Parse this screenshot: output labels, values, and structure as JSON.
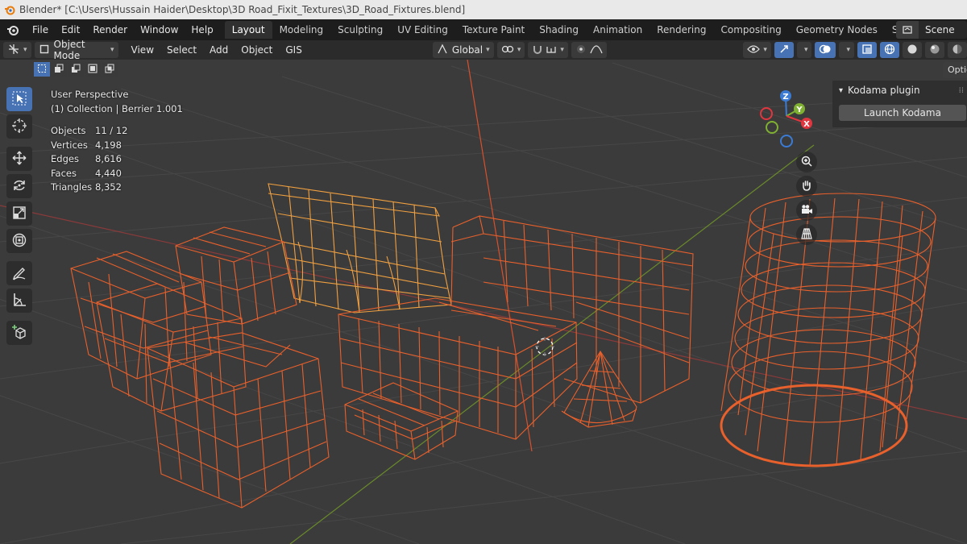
{
  "titlebar": {
    "text": "Blender* [C:\\Users\\Hussain Haider\\Desktop\\3D Road_Fixit_Textures\\3D_Road_Fixtures.blend]"
  },
  "menu": {
    "items": [
      "File",
      "Edit",
      "Render",
      "Window",
      "Help"
    ],
    "workspaces": [
      "Layout",
      "Modeling",
      "Sculpting",
      "UV Editing",
      "Texture Paint",
      "Shading",
      "Animation",
      "Rendering",
      "Compositing",
      "Geometry Nodes",
      "Scripting"
    ],
    "active_workspace": "Layout",
    "scene": "Scene"
  },
  "header": {
    "mode": "Object Mode",
    "menus": [
      "View",
      "Select",
      "Add",
      "Object",
      "GIS"
    ],
    "orientation": "Global",
    "options_tab": "Optio"
  },
  "overlay": {
    "perspective": "User Perspective",
    "collection": "(1) Collection | Berrier 1.001",
    "stats": [
      {
        "label": "Objects",
        "value": "11 / 12"
      },
      {
        "label": "Vertices",
        "value": "4,198"
      },
      {
        "label": "Edges",
        "value": "8,616"
      },
      {
        "label": "Faces",
        "value": "4,440"
      },
      {
        "label": "Triangles",
        "value": "8,352"
      }
    ]
  },
  "gizmo": {
    "x_label": "X",
    "y_label": "Y",
    "z_label": "Z"
  },
  "sidebar": {
    "panel_title": "Kodama plugin",
    "button": "Launch Kodama"
  },
  "colors": {
    "wire": "#e8602c",
    "wire_active": "#f0a040",
    "accent": "#4772b3",
    "x_axis": "#e0363f",
    "y_axis": "#7fb032",
    "z_axis": "#3b7bd4"
  }
}
